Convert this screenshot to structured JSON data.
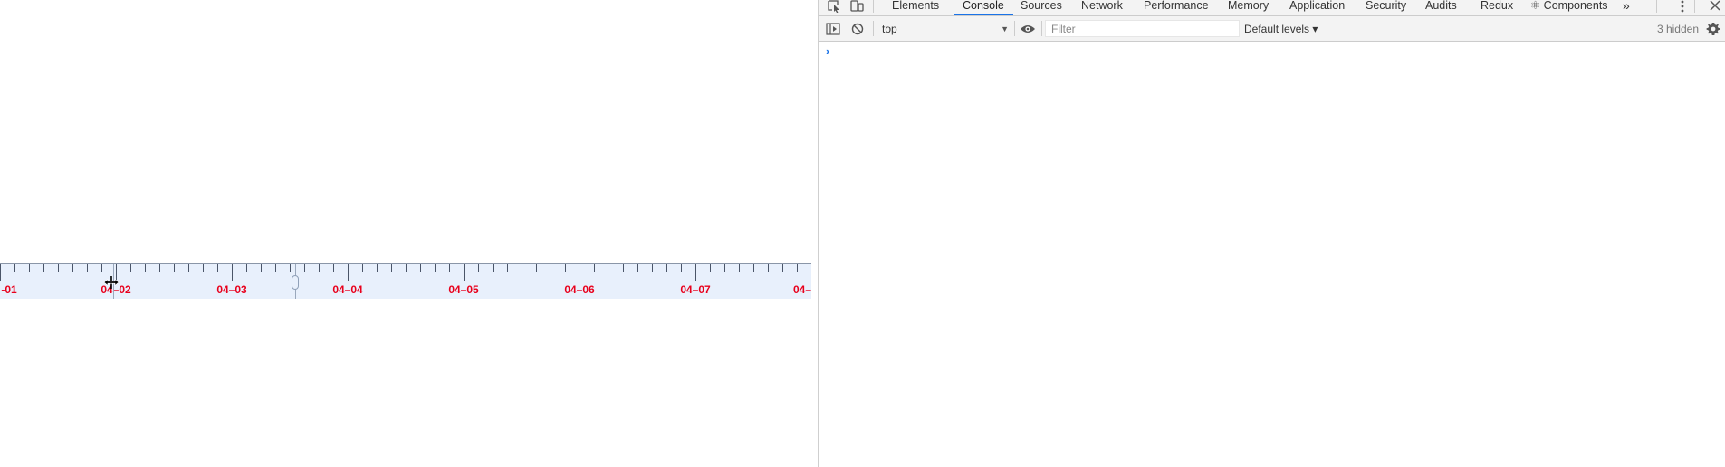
{
  "timeline": {
    "dates": [
      "-01",
      "04–02",
      "04–03",
      "04–04",
      "04–05",
      "04–06",
      "04–07",
      "04–"
    ],
    "label_color": "#e8001c",
    "background": "#e8f0fc"
  },
  "devtools": {
    "tabs": [
      {
        "label": "Elements",
        "active": false
      },
      {
        "label": "Console",
        "active": true
      },
      {
        "label": "Sources",
        "active": false
      },
      {
        "label": "Network",
        "active": false
      },
      {
        "label": "Performance",
        "active": false
      },
      {
        "label": "Memory",
        "active": false
      },
      {
        "label": "Application",
        "active": false
      },
      {
        "label": "Security",
        "active": false
      },
      {
        "label": "Audits",
        "active": false
      },
      {
        "label": "Redux",
        "active": false
      },
      {
        "label": "⚛ Components",
        "active": false
      }
    ],
    "overflow_label": "»",
    "toolbar": {
      "context": "top",
      "filter_placeholder": "Filter",
      "filter_value": "",
      "levels_label": "Default levels ▾",
      "hidden_count": "3 hidden"
    },
    "console": {
      "prompt": "›"
    },
    "accent_color": "#1a73e8"
  }
}
